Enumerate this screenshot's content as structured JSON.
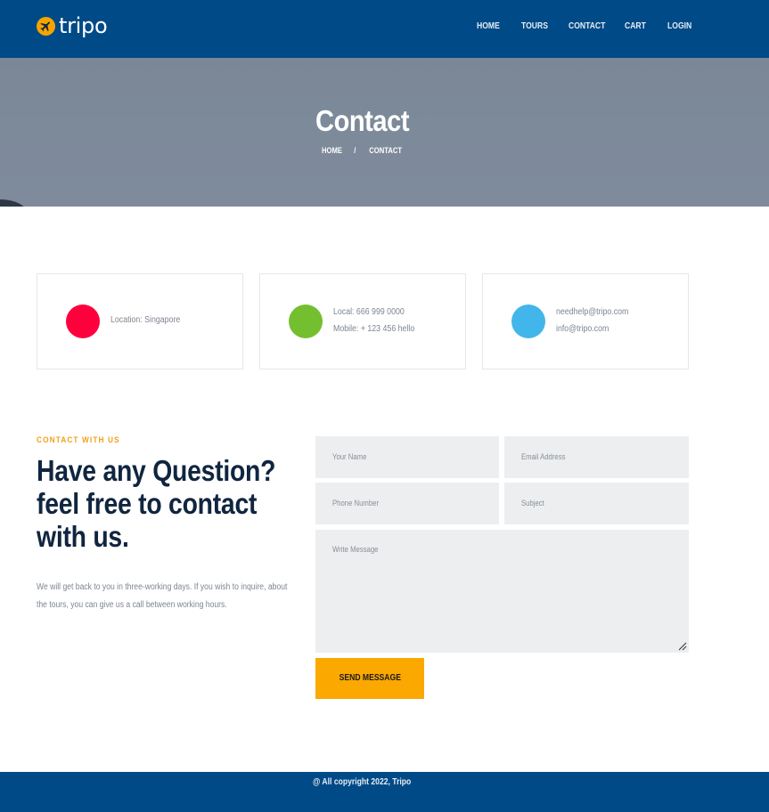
{
  "header": {
    "logo_text": "tripo",
    "logo_icon": "plane-icon",
    "nav": [
      "HOME",
      "TOURS",
      "CONTACT",
      "CART",
      "LOGIN"
    ]
  },
  "banner": {
    "title": "Contact",
    "breadcrumb": {
      "home": "HOME",
      "separator": "/",
      "current": "CONTACT"
    }
  },
  "info_cards": [
    {
      "icon_color": "#ff003c",
      "lines": [
        "Location: Singapore"
      ]
    },
    {
      "icon_color": "#74bf2f",
      "lines": [
        "Local: 666 999 0000",
        "Mobile: + 123 456 hello"
      ]
    },
    {
      "icon_color": "#42b6ea",
      "lines": [
        "needhelp@tripo.com",
        "info@tripo.com"
      ]
    }
  ],
  "contact": {
    "eyebrow": "CONTACT WITH US",
    "heading_lines": [
      "Have any Question?",
      "feel free to contact",
      "with us."
    ],
    "paragraph": "We will get back to you in three-working days. If you wish to inquire, about the tours, you can give us a call between working hours.",
    "form": {
      "name_placeholder": "Your Name",
      "email_placeholder": "Email Address",
      "phone_placeholder": "Phone Number",
      "subject_placeholder": "Subject",
      "message_placeholder": "Write Message",
      "submit_label": "SEND MESSAGE"
    }
  },
  "footer": {
    "copyright": "@ All copyright 2022, Tripo"
  },
  "colors": {
    "primary": "#004a87",
    "accent": "#fba800",
    "heading": "#10253f"
  }
}
